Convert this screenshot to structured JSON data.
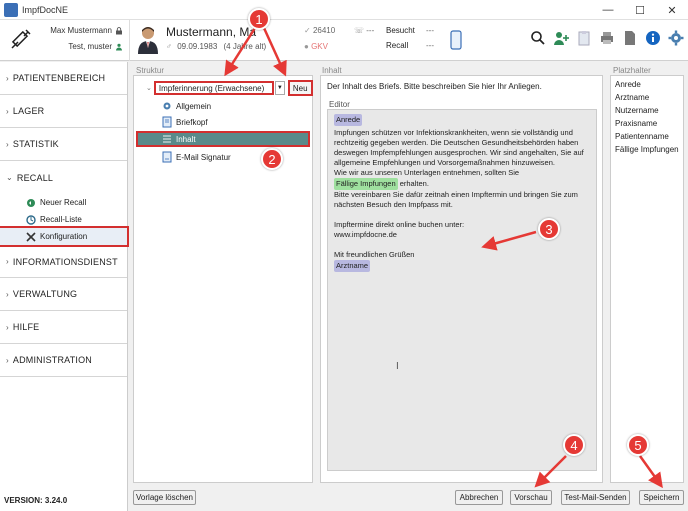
{
  "window": {
    "title": "ImpfDocNE"
  },
  "user": {
    "name": "Max Mustermann",
    "account": "Test, muster"
  },
  "patient": {
    "name": "Mustermann, Ma",
    "dob": "09.09.1983",
    "age": "(4  Jahre alt)",
    "zip": "26410",
    "zip_extra": "---",
    "insurance": "GKV",
    "visit_label": "Besucht",
    "visit_value": "---",
    "recall_label": "Recall",
    "recall_value": "---"
  },
  "sidebar": {
    "sections": [
      {
        "label": "PATIENTENBEREICH"
      },
      {
        "label": "LAGER"
      },
      {
        "label": "STATISTIK"
      },
      {
        "label": "RECALL"
      }
    ],
    "recall_items": [
      {
        "label": "Neuer Recall"
      },
      {
        "label": "Recall-Liste"
      },
      {
        "label": "Konfiguration"
      }
    ],
    "sections_after": [
      {
        "label": "INFORMATIONSDIENST"
      },
      {
        "label": "VERWALTUNG"
      },
      {
        "label": "HILFE"
      },
      {
        "label": "ADMINISTRATION"
      }
    ],
    "version": "VERSION: 3.24.0"
  },
  "struktur": {
    "label": "Struktur",
    "selected_template": "Impferinnerung (Erwachsene)",
    "new_button": "Neu",
    "tree": [
      {
        "label": "Allgemein"
      },
      {
        "label": "Briefkopf"
      },
      {
        "label": "Inhalt"
      },
      {
        "label": "E-Mail Signatur"
      }
    ],
    "delete_button": "Vorlage löschen"
  },
  "inhalt": {
    "label": "Inhalt",
    "description": "Der Inhalt des Briefs. Bitte beschreiben Sie hier Ihr Anliegen.",
    "editor_label": "Editor",
    "ph_anrede": "Anrede",
    "p1": "Impfungen schützen vor Infektionskrankheiten, wenn sie vollständig und rechtzeitig gegeben werden. Die Deutschen Gesundheitsbehörden haben deswegen Impfempfehlungen ausgesprochen. Wir sind angehalten, Sie auf allgemeine Empfehlungen und Vorsorgemaßnahmen hinzuweisen.",
    "p2": "Wie wir aus unseren Unterlagen entnehmen, sollten Sie",
    "ph_impfungen": "Fällige Impfungen",
    "p2b": "erhalten.",
    "p3": "Bitte vereinbaren Sie dafür zeitnah einen Impftermin und bringen Sie zum nächsten Besuch den Impfpass mit.",
    "p4": "Impftermine direkt online buchen unter:",
    "p5": "www.impfdocne.de",
    "p6": "Mit freundlichen Grüßen",
    "ph_arztname": "Arztname"
  },
  "platzhalter": {
    "label": "Platzhalter",
    "items": [
      "Anrede",
      "Arztname",
      "Nutzername",
      "Praxisname",
      "Patientenname",
      "Fällige Impfungen"
    ]
  },
  "buttons": {
    "abbrechen": "Abbrechen",
    "vorschau": "Vorschau",
    "testmail": "Test-Mail-Senden",
    "speichern": "Speichern"
  },
  "markers": [
    "1",
    "2",
    "3",
    "4",
    "5"
  ],
  "colors": {
    "accent_red": "#d32f2f",
    "marker_red": "#e53935",
    "selected_teal": "#5a8a8a",
    "placeholder_blue": "#b8b8e0",
    "placeholder_green": "#9fe09f"
  }
}
